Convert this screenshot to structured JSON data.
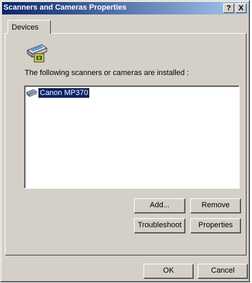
{
  "window": {
    "title": "Scanners and Cameras Properties",
    "help_label": "?",
    "close_label": "X"
  },
  "tabs": [
    {
      "label": "Devices"
    }
  ],
  "devices_tab": {
    "intro_text": "The following scanners or cameras are installed :",
    "devices": [
      {
        "name": "Canon MP370",
        "selected": true,
        "icon": "scanner-icon"
      }
    ]
  },
  "buttons": {
    "add": "Add...",
    "remove": "Remove",
    "troubleshoot": "Troubleshoot",
    "properties": "Properties",
    "ok": "OK",
    "cancel": "Cancel"
  },
  "colors": {
    "title_active": "#0a246a",
    "title_gradient_end": "#a6caf0",
    "face": "#d4d0c8",
    "selection": "#0a246a"
  }
}
